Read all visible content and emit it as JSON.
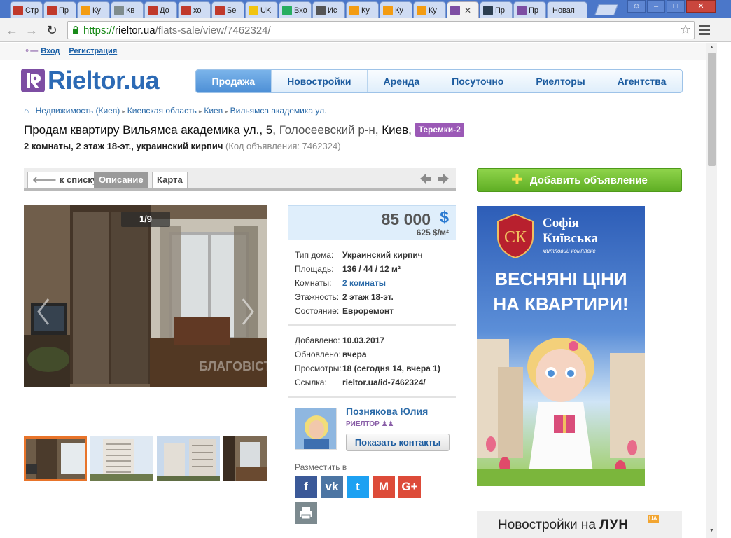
{
  "browser": {
    "tabs": [
      {
        "label": "Стр",
        "fav": "#c0392b"
      },
      {
        "label": "Пр",
        "fav": "#c0392b"
      },
      {
        "label": "Ку",
        "fav": "#f39c12"
      },
      {
        "label": "Кв",
        "fav": "#7f8c8d"
      },
      {
        "label": "До",
        "fav": "#c0392b"
      },
      {
        "label": "хо",
        "fav": "#c0392b"
      },
      {
        "label": "Бе",
        "fav": "#c0392b"
      },
      {
        "label": "UK",
        "fav": "#f1c40f"
      },
      {
        "label": "Вхо",
        "fav": "#27ae60"
      },
      {
        "label": "Ис",
        "fav": "#555555"
      },
      {
        "label": "Ку",
        "fav": "#f39c12"
      },
      {
        "label": "Ку",
        "fav": "#f39c12"
      },
      {
        "label": "Ку",
        "fav": "#f39c12"
      },
      {
        "label": "",
        "fav": "#7d4ea3",
        "active": true
      },
      {
        "label": "Пр",
        "fav": "#2c3e50"
      },
      {
        "label": "Пр",
        "fav": "#7d4ea3"
      },
      {
        "label": "Новая",
        "fav": ""
      }
    ],
    "url_scheme": "https://",
    "url_host": "rieltor.ua",
    "url_path": "/flats-sale/view/7462324/"
  },
  "top": {
    "login": "Вход",
    "register": "Регистрация"
  },
  "logo": {
    "text": "Rieltor.ua"
  },
  "nav": {
    "items": [
      "Продажа",
      "Новостройки",
      "Аренда",
      "Посуточно",
      "Риелторы",
      "Агентства"
    ]
  },
  "breadcrumbs": [
    "Недвижимость (Киев)",
    "Киевская область",
    "Киев",
    "Вильямса академика ул."
  ],
  "title": {
    "main": "Продам квартиру Вильямса академика ул., 5,",
    "district": "Голосеевский р-н",
    "city": ", Киев,",
    "badge": "Теремки-2"
  },
  "subtitle": {
    "text": "2 комнаты, 2 этаж 18-эт., украинский кирпич",
    "code": "(Код объявления: 7462324)"
  },
  "listing_tabs": {
    "back": "к списку",
    "description": "Описание",
    "map": "Карта"
  },
  "gallery": {
    "counter": "1/9",
    "watermark": "БЛАГОВІСТ"
  },
  "price": {
    "amount": "85 000",
    "currency": "$",
    "per_m2": "625 $/м²"
  },
  "props": [
    {
      "k": "Тип дома:",
      "v": "Украинский кирпич"
    },
    {
      "k": "Площадь:",
      "v": "136 / 44 / 12 м²"
    },
    {
      "k": "Комнаты:",
      "v": "2 комнаты",
      "link": true
    },
    {
      "k": "Этажность:",
      "v": "2 этаж 18-эт."
    },
    {
      "k": "Состояние:",
      "v": "Евроремонт"
    }
  ],
  "meta": [
    {
      "k": "Добавлено:",
      "v": "10.03.2017"
    },
    {
      "k": "Обновлено:",
      "v": "вчера"
    },
    {
      "k": "Просмотры:",
      "v": "18 (сегодня 14, вчера 1)"
    },
    {
      "k": "Ссылка:",
      "v": "rieltor.ua/id-7462324/"
    }
  ],
  "agent": {
    "name": "Познякова Юлия",
    "role": "РИЕЛТОР",
    "contacts_button": "Показать контакты"
  },
  "share": {
    "label": "Разместить в",
    "networks": [
      {
        "name": "facebook",
        "glyph": "f",
        "color": "#3b5998"
      },
      {
        "name": "vkontakte",
        "glyph": "vk",
        "color": "#4c75a3"
      },
      {
        "name": "twitter",
        "glyph": "t",
        "color": "#1da1f2"
      },
      {
        "name": "gmail",
        "glyph": "M",
        "color": "#dd4b39"
      },
      {
        "name": "google-plus",
        "glyph": "G+",
        "color": "#dd4b39"
      }
    ]
  },
  "sidebar": {
    "add_button": "Добавить объявление",
    "banner_brand_line1": "Софія",
    "banner_brand_line2": "Київська",
    "banner_sub": "житловий комплекс",
    "banner_title_line1": "ВЕСНЯНІ ЦІНИ",
    "banner_title_line2": "НА КВАРТИРИ!",
    "lun_prefix": "Новостройки на",
    "lun_brand": "ЛУН",
    "lun_tag": "UA"
  }
}
